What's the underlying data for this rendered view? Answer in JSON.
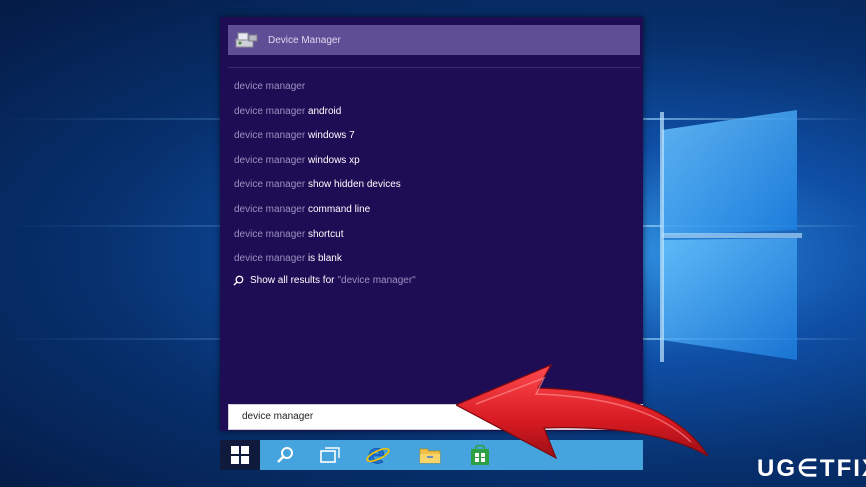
{
  "start_menu": {
    "top_result": {
      "label": "Device Manager",
      "icon": "device-manager-icon"
    },
    "suggestions": [
      {
        "prefix": "device manager",
        "rest": ""
      },
      {
        "prefix": "device manager ",
        "rest": "android"
      },
      {
        "prefix": "device manager ",
        "rest": "windows 7"
      },
      {
        "prefix": "device manager ",
        "rest": "windows xp"
      },
      {
        "prefix": "device manager ",
        "rest": "show hidden devices"
      },
      {
        "prefix": "device manager ",
        "rest": "command line"
      },
      {
        "prefix": "device manager ",
        "rest": "shortcut"
      },
      {
        "prefix": "device manager ",
        "rest": "is blank"
      }
    ],
    "show_all": {
      "label": "Show all results for",
      "query": "\"device manager\""
    }
  },
  "search_box": {
    "value": "device manager"
  },
  "taskbar": {
    "icons": [
      "windows-start-icon",
      "search-icon",
      "task-view-icon",
      "internet-explorer-icon",
      "file-explorer-icon",
      "store-icon"
    ]
  },
  "watermark": {
    "text": "UG∈TFIX"
  },
  "colors": {
    "panel": "#1e0c55",
    "top_result_highlight": "#5f4e95",
    "taskbar": "#45a4dd",
    "arrow": "#e0232b"
  }
}
